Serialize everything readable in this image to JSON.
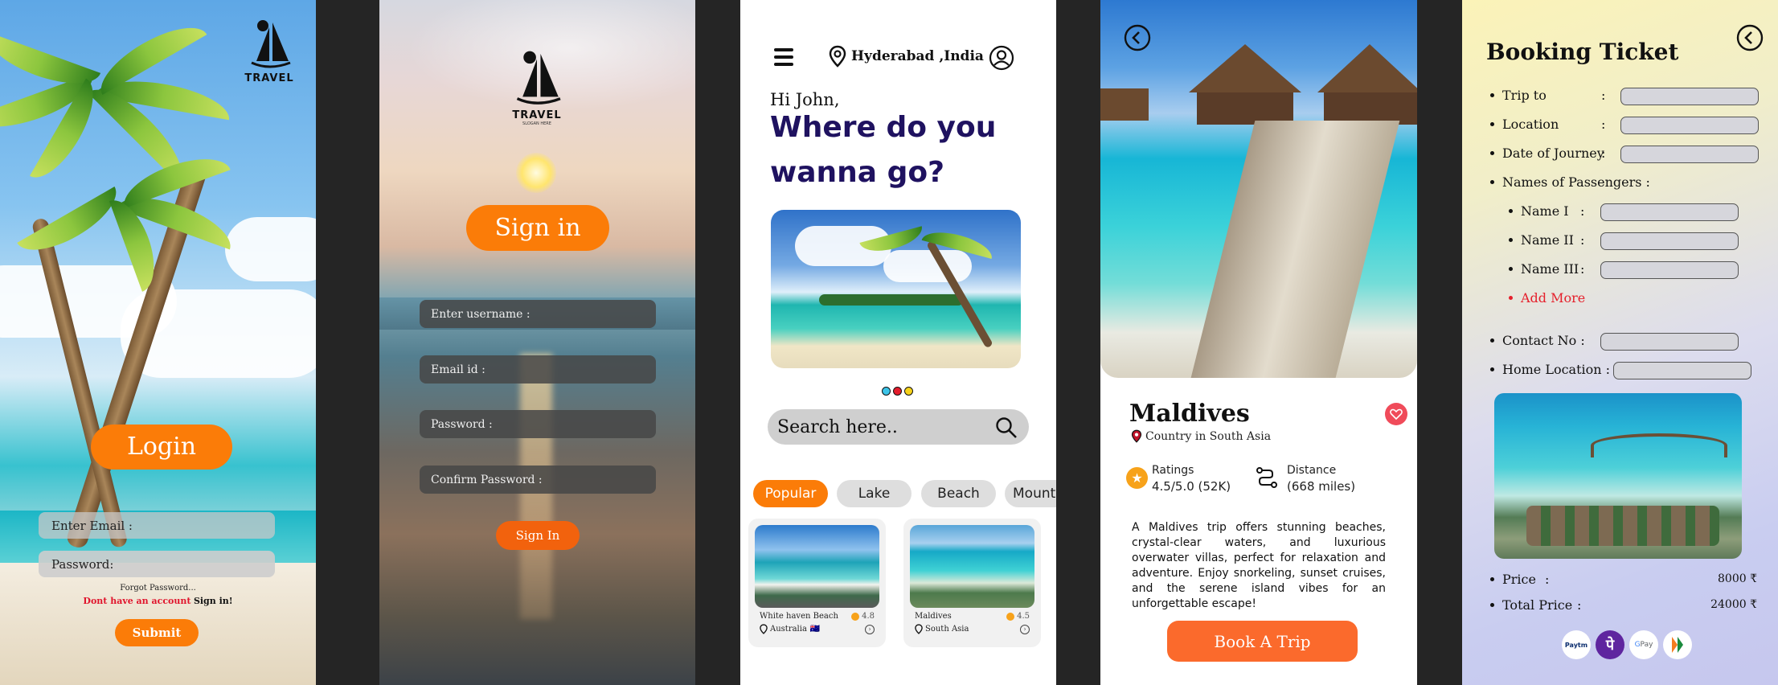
{
  "login": {
    "logo_text": "TRAVEL",
    "button": "Login",
    "email_label": "Enter Email :",
    "password_label": "Password:",
    "forgot": "Forgot Password...",
    "no_account": "Dont have an account",
    "sign_in_link": "Sign in!",
    "submit": "Submit"
  },
  "signup": {
    "logo_text": "TRAVEL",
    "logo_tagline": "SLOGAN HERE",
    "heading": "Sign in",
    "fields": [
      "Enter username :",
      "Email id :",
      "Password :",
      "Confirm Password :"
    ],
    "button": "Sign In"
  },
  "home": {
    "location": "Hyderabad ,India",
    "greeting": "Hi John,",
    "headline_1": "Where do you",
    "headline_2": "wanna go?",
    "search_placeholder": "Search here..",
    "chips": [
      "Popular",
      "Lake",
      "Beach",
      "Mount"
    ],
    "cards": [
      {
        "name": "White haven Beach",
        "location": "Australia",
        "flag": "🇦🇺",
        "rating": "4.8"
      },
      {
        "name": "Maldives",
        "location": "South Asia",
        "rating": "4.5"
      }
    ],
    "colors": {
      "accent": "#fb7c08",
      "headline": "#1f1260"
    }
  },
  "detail": {
    "title": "Maldives",
    "subtitle": "Country in South Asia",
    "ratings_label": "Ratings",
    "ratings_value": "4.5/5.0 (52K)",
    "distance_label": "Distance",
    "distance_value": "(668 miles)",
    "description": "A Maldives trip offers stunning beaches, crystal-clear waters, and luxurious overwater villas, perfect for relaxation and adventure. Enjoy snorkeling, sunset cruises, and the serene island vibes for an unforgettable escape!",
    "button": "Book A Trip"
  },
  "booking": {
    "title": "Booking Ticket",
    "trip_to": "Trip to",
    "location": "Location",
    "date": "Date of Journey",
    "passengers": "Names of Passengers :",
    "names": [
      "Name I",
      "Name II",
      "Name III"
    ],
    "add_more": "Add More",
    "contact": "Contact No :",
    "home_location": "Home Location :",
    "price_label": "Price",
    "price_value": "8000 ₹",
    "total_label": "Total Price",
    "total_value": "24000 ₹",
    "payments": [
      "Paytm",
      "PhonePe",
      "GPay",
      "BHIM"
    ]
  }
}
